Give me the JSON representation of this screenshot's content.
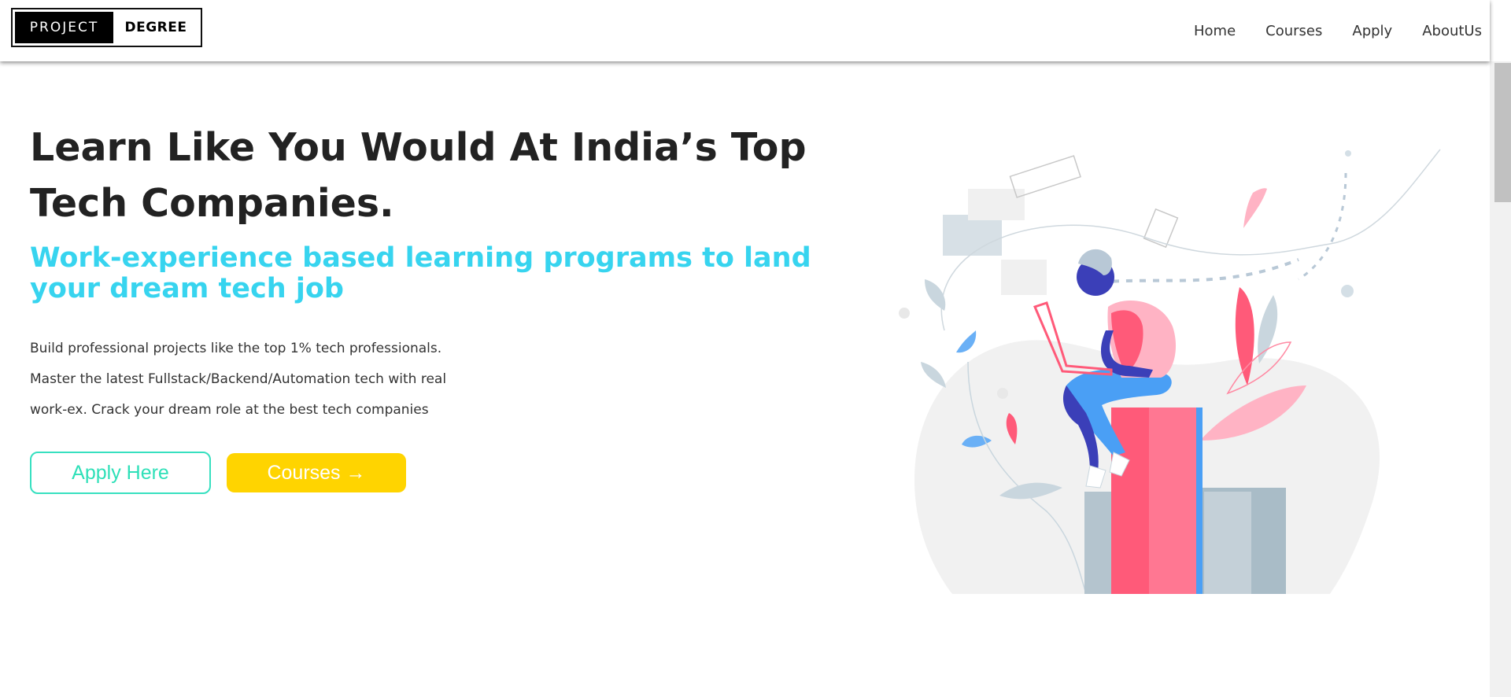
{
  "header": {
    "logo": {
      "left": "PROJECT",
      "right": "DEGREE"
    },
    "nav": [
      {
        "label": "Home"
      },
      {
        "label": "Courses"
      },
      {
        "label": "Apply"
      },
      {
        "label": "AboutUs"
      }
    ]
  },
  "hero": {
    "title": "Learn Like You Would At India’s Top Tech Companies.",
    "subtitle": "Work-experience based learning programs to land your dream tech job",
    "description": "Build professional projects like the top 1% tech professionals. Master the latest Fullstack/Backend/Automation tech with real work-ex. Crack your dream role at the best tech companies",
    "apply_label": "Apply Here",
    "courses_label": "Courses →"
  },
  "colors": {
    "accent_cyan": "#37d4ef",
    "apply_border": "#37e0c0",
    "courses_bg": "#ffd400",
    "illustration_pink": "#ff5a79",
    "illustration_blue": "#4a9ff5",
    "illustration_indigo": "#3b3fb8"
  }
}
